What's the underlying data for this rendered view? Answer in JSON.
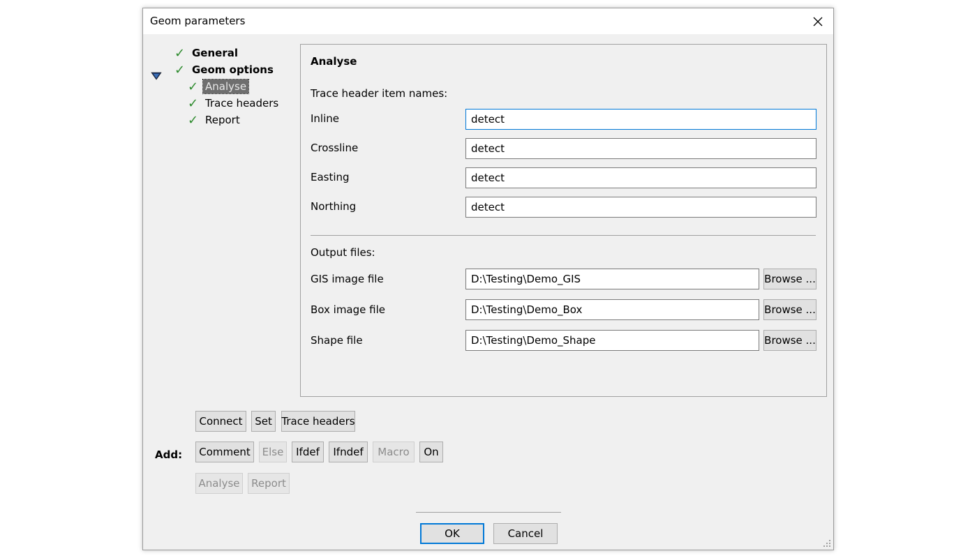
{
  "window": {
    "title": "Geom parameters"
  },
  "tree": {
    "items": [
      {
        "label": "General",
        "checked": true
      },
      {
        "label": "Geom options",
        "checked": true,
        "expanded": true
      },
      {
        "label": "Analyse",
        "checked": true,
        "selected": true
      },
      {
        "label": "Trace headers",
        "checked": true
      },
      {
        "label": "Report",
        "checked": true
      }
    ]
  },
  "panel": {
    "heading": "Analyse",
    "trace_header_section": "Trace header item names:",
    "fields": [
      {
        "label": "Inline",
        "value": "detect"
      },
      {
        "label": "Crossline",
        "value": "detect"
      },
      {
        "label": "Easting",
        "value": "detect"
      },
      {
        "label": "Northing",
        "value": "detect"
      }
    ],
    "output_section": "Output files:",
    "files": [
      {
        "label": "GIS image file",
        "value": "D:\\Testing\\Demo_GIS",
        "browse": "Browse ..."
      },
      {
        "label": "Box image file",
        "value": "D:\\Testing\\Demo_Box",
        "browse": "Browse ..."
      },
      {
        "label": "Shape file",
        "value": "D:\\Testing\\Demo_Shape",
        "browse": "Browse ..."
      }
    ]
  },
  "toolbar": {
    "row1": [
      "Connect",
      "Set",
      "Trace headers"
    ],
    "add_label": "Add:",
    "row2": [
      {
        "label": "Comment",
        "enabled": true
      },
      {
        "label": "Else",
        "enabled": false
      },
      {
        "label": "Ifdef",
        "enabled": true
      },
      {
        "label": "Ifndef",
        "enabled": true
      },
      {
        "label": "Macro",
        "enabled": false
      },
      {
        "label": "On",
        "enabled": true
      }
    ],
    "row3": [
      {
        "label": "Analyse",
        "enabled": false
      },
      {
        "label": "Report",
        "enabled": false
      }
    ]
  },
  "footer": {
    "ok_label": "OK",
    "cancel_label": "Cancel"
  },
  "colors": {
    "check": "#2e8b2e",
    "focus_border": "#0078d7",
    "selected_bg": "#6e6e6e"
  },
  "icons": {
    "close": "close-icon",
    "check": "checkmark-icon",
    "expand": "expand-triangle-icon",
    "grip": "resize-grip-icon"
  }
}
